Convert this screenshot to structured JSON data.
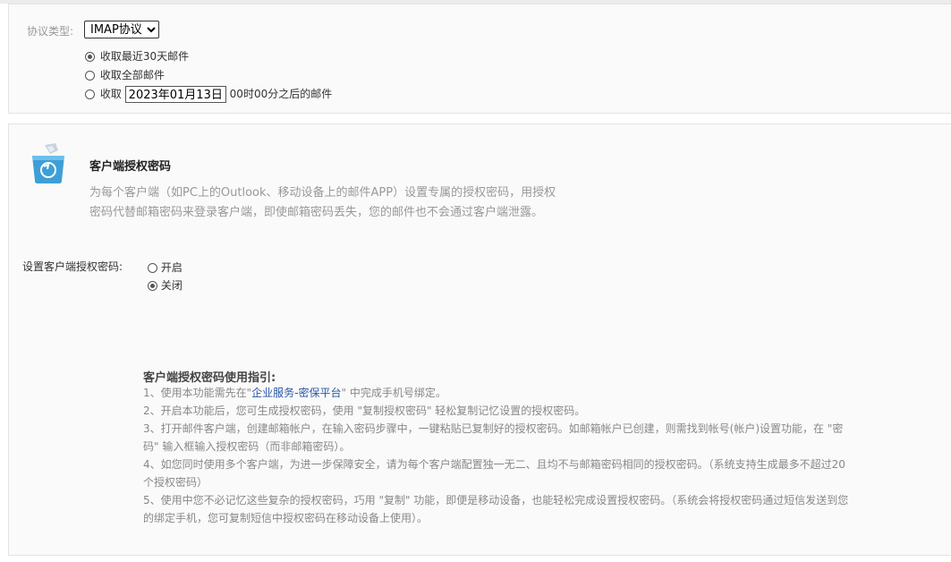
{
  "protocol": {
    "label": "协议类型:",
    "selected": "IMAP协议",
    "options": [
      {
        "label": "收取最近30天邮件",
        "checked": true
      },
      {
        "label": "收取全部邮件",
        "checked": false
      },
      {
        "prefix": "收取",
        "date": "2023年01月13日",
        "suffix": "00时00分之后的邮件",
        "checked": false
      }
    ]
  },
  "client_auth": {
    "icon": "recycle-box-icon",
    "title": "客户端授权密码",
    "desc_line1": "为每个客户端（如PC上的Outlook、移动设备上的邮件APP）设置专属的授权密码，用授权",
    "desc_line2": "密码代替邮箱密码来登录客户端，即使邮箱密码丢失，您的邮件也不会通过客户端泄露。"
  },
  "setting": {
    "label": "设置客户端授权密码:",
    "on_label": "开启",
    "off_label": "关闭",
    "on_checked": false,
    "off_checked": true
  },
  "guide": {
    "title": "客户端授权密码使用指引:",
    "item1_pre": "1、使用本功能需先在\"",
    "item1_link": "企业服务-密保平台",
    "item1_post": "\" 中完成手机号绑定。",
    "item2": "2、开启本功能后，您可生成授权密码，使用 \"复制授权密码\" 轻松复制记忆设置的授权密码。",
    "item3_l1": "3、打开邮件客户端，创建邮箱帐户，在输入密码步骤中，一键粘贴已复制好的授权密码。如邮箱帐户已创建，则需找到帐号(帐户)设置功能，在 \"密",
    "item3_l2": "码\" 输入框输入授权密码（而非邮箱密码）。",
    "item4_l1": "4、如您同时使用多个客户端，为进一步保障安全，请为每个客户端配置独一无二、且均不与邮箱密码相同的授权密码。（系统支持生成最多不超过20",
    "item4_l2": "个授权密码）",
    "item5_l1": "5、使用中您不必记忆这些复杂的授权密码，巧用 \"复制\" 功能，即便是移动设备，也能轻松完成设置授权密码。（系统会将授权密码通过短信发送到您",
    "item5_l2": "的绑定手机，您可复制短信中授权密码在移动设备上使用）。"
  }
}
